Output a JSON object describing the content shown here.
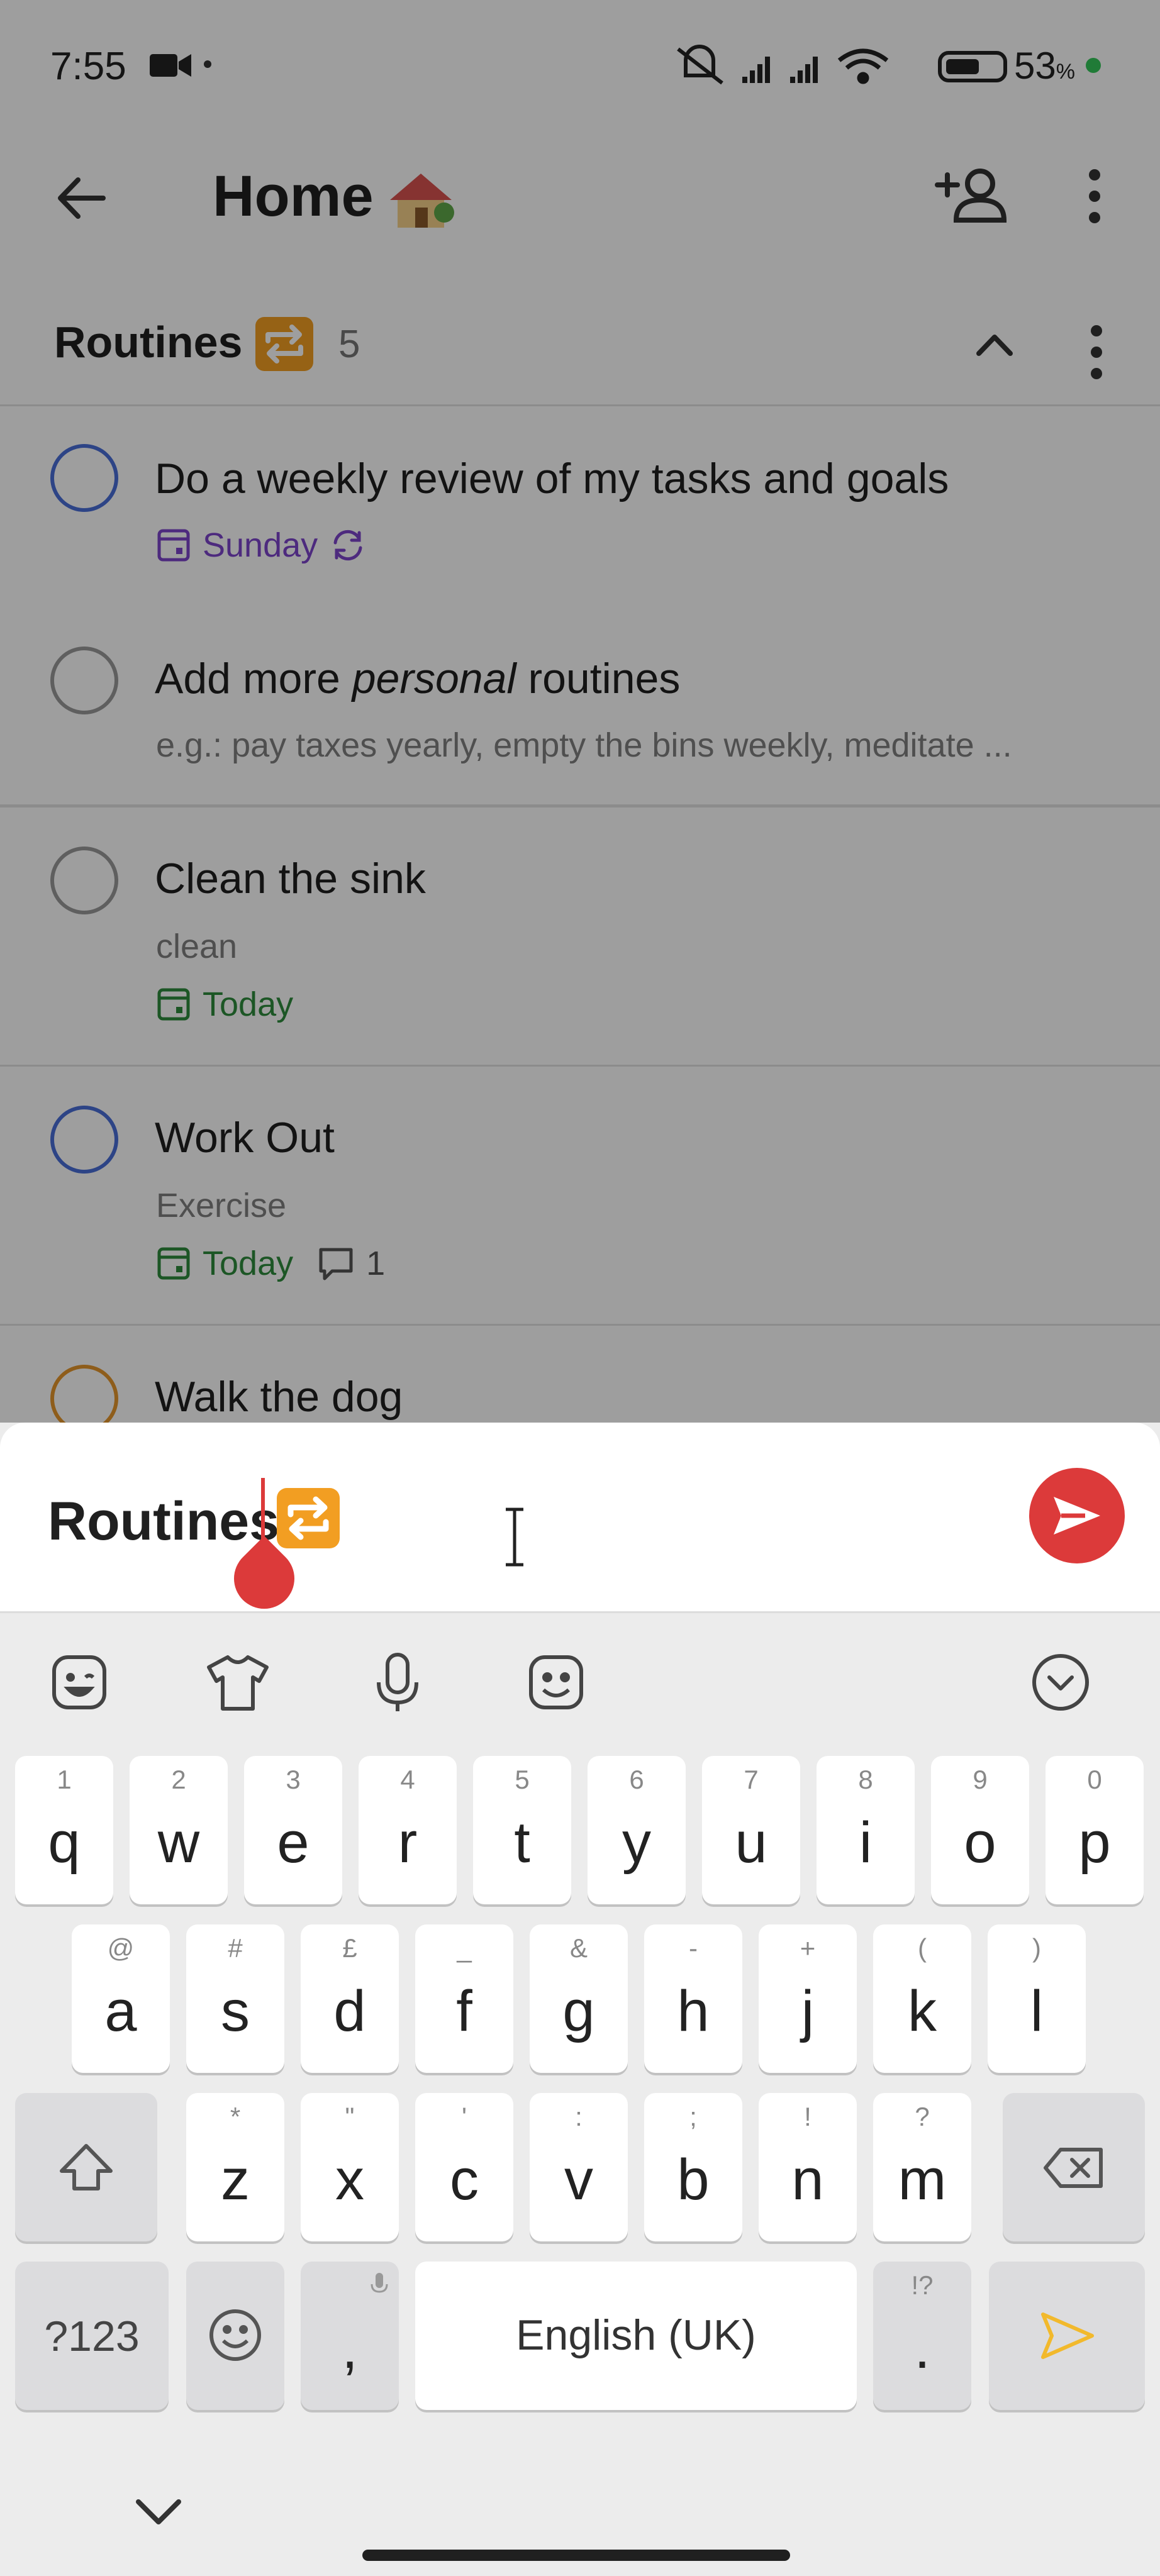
{
  "status_bar": {
    "time": "7:55",
    "battery": "53",
    "battery_unit": "%"
  },
  "header": {
    "title": "Home",
    "title_icon": "house-icon"
  },
  "section": {
    "title": "Routines",
    "title_icon": "repeat-icon",
    "count": "5"
  },
  "tasks": [
    {
      "title_parts": [
        "Do a weekly review of my tasks and goals"
      ],
      "date": "Sunday",
      "recurring": true,
      "check_color": "#4a6fd8",
      "date_color": "#7d45cc"
    },
    {
      "title_parts": [
        "Add more ",
        "personal",
        " routines"
      ],
      "description": "e.g.: pay taxes yearly, empty the bins weekly, meditate ...",
      "check_color": "#9a9a9a"
    },
    {
      "title_parts": [
        "Clean the sink"
      ],
      "description": "clean",
      "date": "Today",
      "check_color": "#9a9a9a",
      "date_color": "#2e8b3c"
    },
    {
      "title_parts": [
        "Work Out"
      ],
      "description": "Exercise",
      "date": "Today",
      "comments": "1",
      "check_color": "#4a6fd8",
      "date_color": "#2e8b3c"
    },
    {
      "title_parts": [
        "Walk the dog"
      ],
      "check_color": "#e6962c"
    }
  ],
  "composer": {
    "text": "Routines",
    "accent": "#dc3a3a"
  },
  "keyboard": {
    "row1": [
      {
        "key": "q",
        "hint": "1"
      },
      {
        "key": "w",
        "hint": "2"
      },
      {
        "key": "e",
        "hint": "3"
      },
      {
        "key": "r",
        "hint": "4"
      },
      {
        "key": "t",
        "hint": "5"
      },
      {
        "key": "y",
        "hint": "6"
      },
      {
        "key": "u",
        "hint": "7"
      },
      {
        "key": "i",
        "hint": "8"
      },
      {
        "key": "o",
        "hint": "9"
      },
      {
        "key": "p",
        "hint": "0"
      }
    ],
    "row2": [
      {
        "key": "a",
        "hint": "@"
      },
      {
        "key": "s",
        "hint": "#"
      },
      {
        "key": "d",
        "hint": "£"
      },
      {
        "key": "f",
        "hint": "_"
      },
      {
        "key": "g",
        "hint": "&"
      },
      {
        "key": "h",
        "hint": "-"
      },
      {
        "key": "j",
        "hint": "+"
      },
      {
        "key": "k",
        "hint": "("
      },
      {
        "key": "l",
        "hint": ")"
      }
    ],
    "row3": [
      {
        "key": "z",
        "hint": "*"
      },
      {
        "key": "x",
        "hint": "\""
      },
      {
        "key": "c",
        "hint": "'"
      },
      {
        "key": "v",
        "hint": ":"
      },
      {
        "key": "b",
        "hint": ";"
      },
      {
        "key": "n",
        "hint": "!"
      },
      {
        "key": "m",
        "hint": "?"
      }
    ],
    "symbols_label": "?123",
    "comma": ",",
    "space_label": "English (UK)",
    "period": ".",
    "period_hint": "!?",
    "enter_color": "#f2b92c"
  }
}
